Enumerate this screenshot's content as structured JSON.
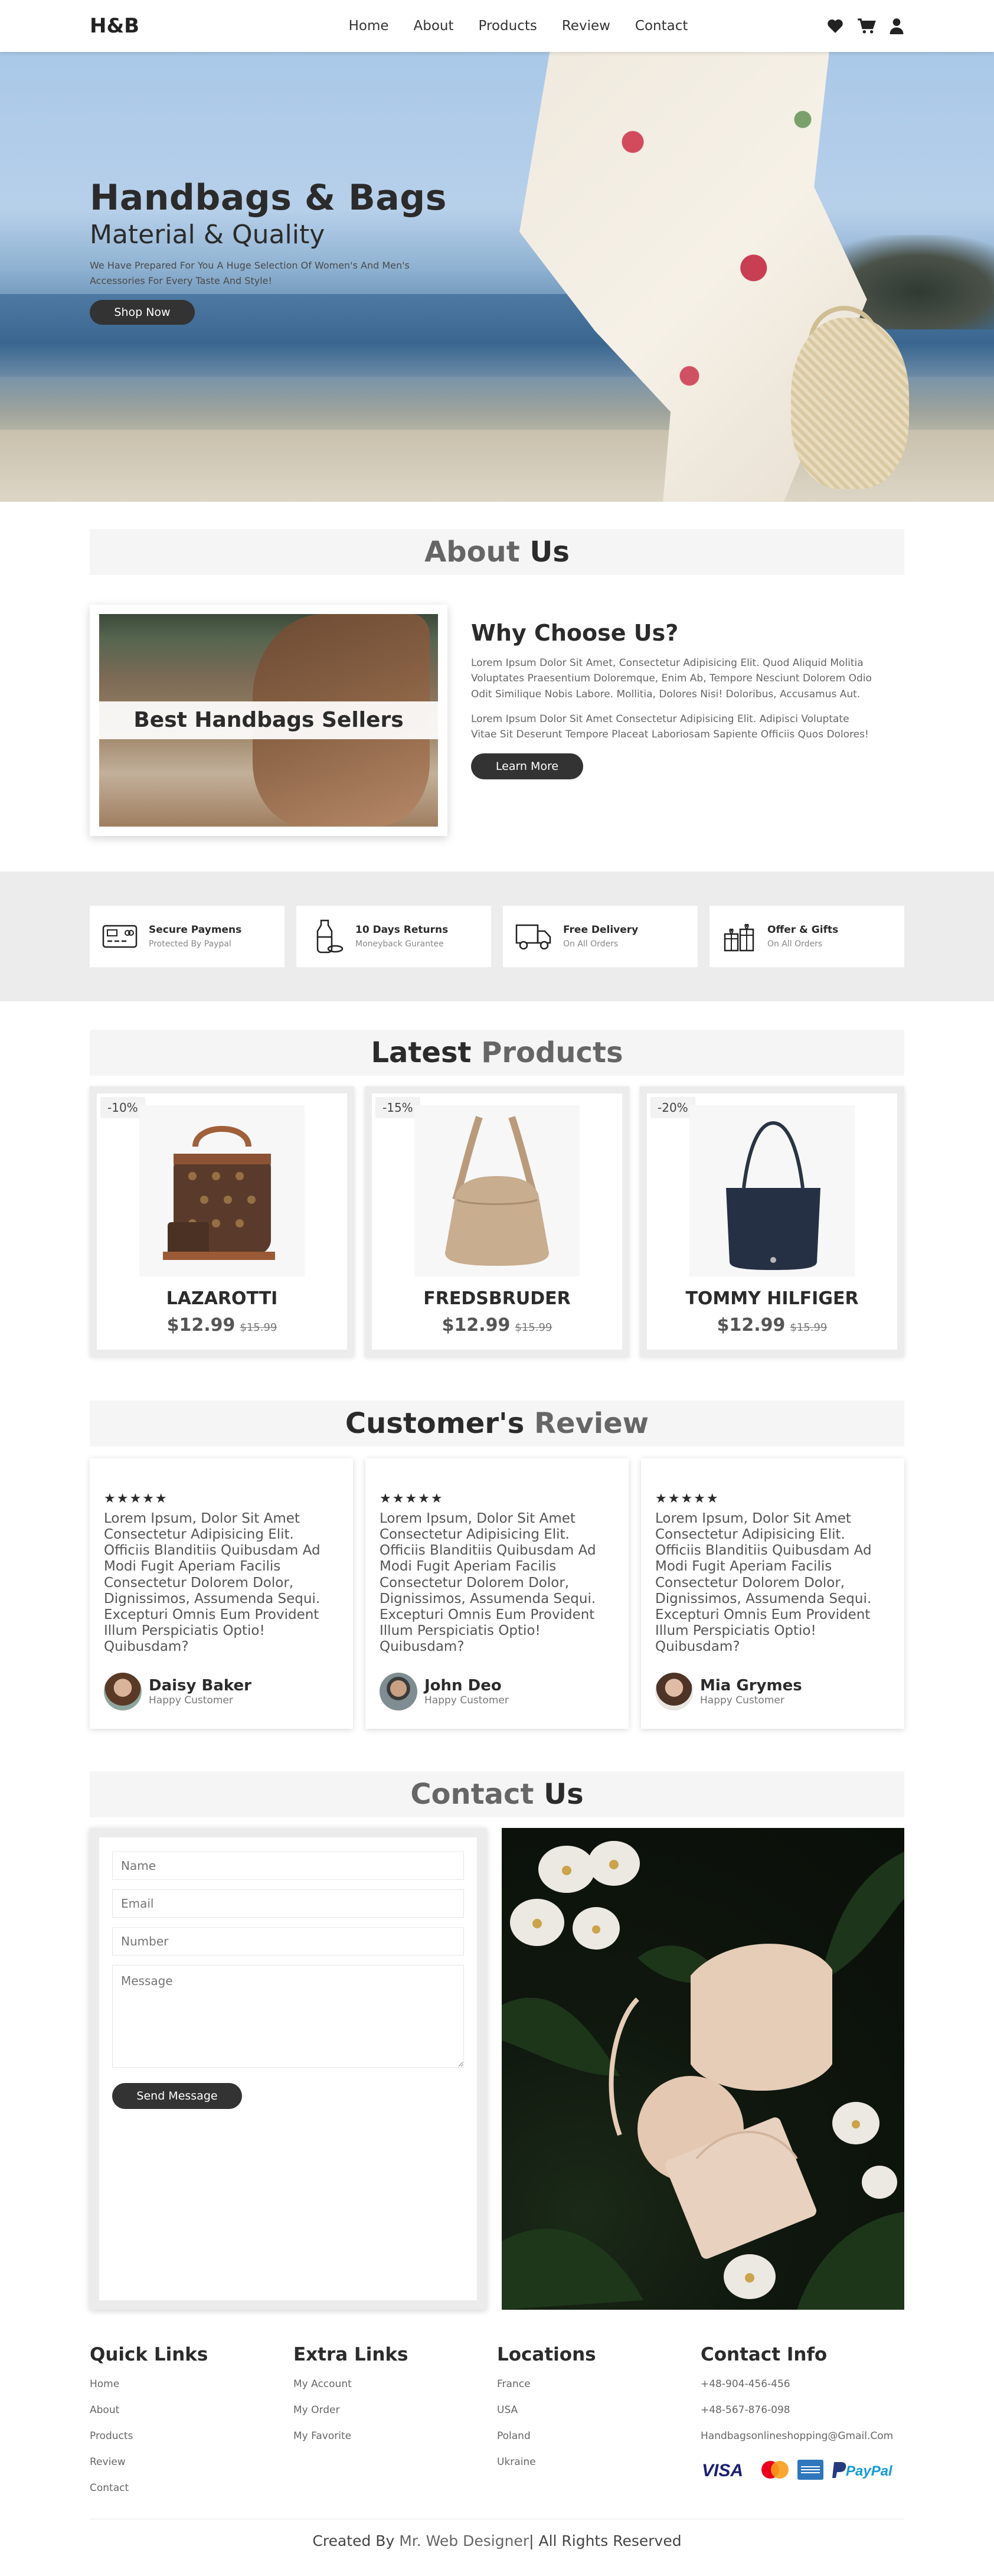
{
  "header": {
    "logo": "H&B",
    "nav": [
      "Home",
      "About",
      "Products",
      "Review",
      "Contact"
    ],
    "icons": [
      "heart-icon",
      "cart-icon",
      "user-icon"
    ]
  },
  "hero": {
    "title": "Handbags & Bags",
    "subtitle": "Material & Quality",
    "text": "We Have Prepared For You A Huge Selection Of Women's And Men's Accessories For Every Taste And Style!",
    "button": "Shop Now"
  },
  "about": {
    "title_a": "About",
    "title_b": "Us",
    "image_caption": "Best Handbags Sellers",
    "heading": "Why Choose Us?",
    "p1": "Lorem Ipsum Dolor Sit Amet, Consectetur Adipisicing Elit. Quod Aliquid Molitia Voluptates Praesentium Doloremque, Enim Ab, Tempore Nesciunt Dolorem Odio Odit Similique Nobis Labore. Mollitia, Dolores Nisi! Doloribus, Accusamus Aut.",
    "p2": "Lorem Ipsum Dolor Sit Amet Consectetur Adipisicing Elit. Adipisci Voluptate Vitae Sit Deserunt Tempore Placeat Laboriosam Sapiente Officiis Quos Dolores!",
    "button": "Learn More"
  },
  "features": [
    {
      "title": "Secure Paymens",
      "sub": "Protected By Paypal",
      "icon": "card-icon"
    },
    {
      "title": "10 Days Returns",
      "sub": "Moneyback Gurantee",
      "icon": "bottle-icon"
    },
    {
      "title": "Free Delivery",
      "sub": "On All Orders",
      "icon": "truck-icon"
    },
    {
      "title": "Offer & Gifts",
      "sub": "On All Orders",
      "icon": "gift-icon"
    }
  ],
  "products": {
    "title_a": "Latest",
    "title_b": "Products",
    "items": [
      {
        "discount": "-10%",
        "name": "LAZAROTTI",
        "price": "$12.99",
        "old": "$15.99"
      },
      {
        "discount": "-15%",
        "name": "FREDSBRUDER",
        "price": "$12.99",
        "old": "$15.99"
      },
      {
        "discount": "-20%",
        "name": "TOMMY HILFIGER",
        "price": "$12.99",
        "old": "$15.99"
      }
    ]
  },
  "reviews": {
    "title_a": "Customer's",
    "title_b": "Review",
    "stars": "★★★★★",
    "items": [
      {
        "text": "Lorem Ipsum, Dolor Sit Amet Consectetur Adipisicing Elit. Officiis Blanditiis Quibusdam Ad Modi Fugit Aperiam Facilis Consectetur Dolorem Dolor, Dignissimos, Assumenda Sequi. Excepturi Omnis Eum Provident Illum Perspiciatis Optio! Quibusdam?",
        "name": "Daisy Baker",
        "role": "Happy Customer"
      },
      {
        "text": "Lorem Ipsum, Dolor Sit Amet Consectetur Adipisicing Elit. Officiis Blanditiis Quibusdam Ad Modi Fugit Aperiam Facilis Consectetur Dolorem Dolor, Dignissimos, Assumenda Sequi. Excepturi Omnis Eum Provident Illum Perspiciatis Optio! Quibusdam?",
        "name": "John Deo",
        "role": "Happy Customer"
      },
      {
        "text": "Lorem Ipsum, Dolor Sit Amet Consectetur Adipisicing Elit. Officiis Blanditiis Quibusdam Ad Modi Fugit Aperiam Facilis Consectetur Dolorem Dolor, Dignissimos, Assumenda Sequi. Excepturi Omnis Eum Provident Illum Perspiciatis Optio! Quibusdam?",
        "name": "Mia Grymes",
        "role": "Happy Customer"
      }
    ]
  },
  "contact": {
    "title_a": "Contact",
    "title_b": "Us",
    "name_ph": "Name",
    "email_ph": "Email",
    "number_ph": "Number",
    "message_ph": "Message",
    "button": "Send Message"
  },
  "footer": {
    "quick": {
      "title": "Quick Links",
      "links": [
        "Home",
        "About",
        "Products",
        "Review",
        "Contact"
      ]
    },
    "extra": {
      "title": "Extra Links",
      "links": [
        "My Account",
        "My Order",
        "My Favorite"
      ]
    },
    "locations": {
      "title": "Locations",
      "links": [
        "France",
        "USA",
        "Poland",
        "Ukraine"
      ]
    },
    "info": {
      "title": "Contact Info",
      "links": [
        "+48-904-456-456",
        "+48-567-876-098",
        "Handbagsonlineshopping@Gmail.Com"
      ]
    },
    "payments": [
      "VISA",
      "PayPal"
    ],
    "credit_a": "Created By",
    "credit_b": "Mr. Web Designer",
    "credit_c": "| All Rights Reserved"
  }
}
